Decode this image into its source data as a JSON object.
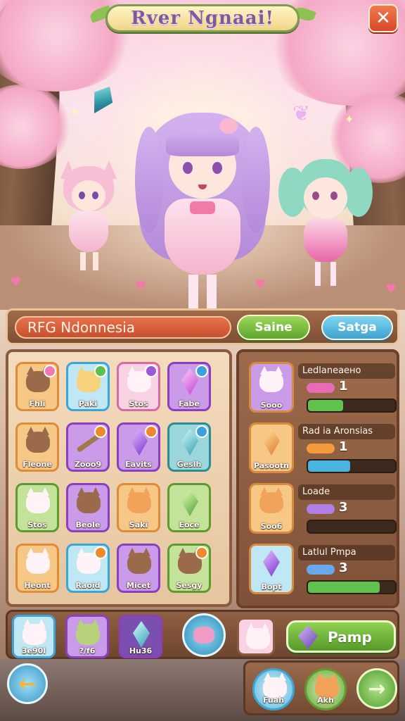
{
  "title": "Rver Ngnaai!",
  "region": {
    "name": "RFG Ndonnesia",
    "save_label": "Saine",
    "setup_label": "Satga"
  },
  "grid": {
    "items": [
      {
        "label": "Fhli",
        "rarity": "orange",
        "art": "cat-brown",
        "badge": "flower"
      },
      {
        "label": "Paki",
        "rarity": "blue",
        "art": "girl-blonde",
        "badge": "green-gem"
      },
      {
        "label": "Stos",
        "rarity": "pink",
        "art": "cat-white",
        "badge": "purple-gem"
      },
      {
        "label": "Fabe",
        "rarity": "purple",
        "art": "gem-pink",
        "badge": "blue-gem"
      },
      {
        "label": "Fleone",
        "rarity": "orange",
        "art": "cat-brown",
        "badge": ""
      },
      {
        "label": "Zooo9",
        "rarity": "purple",
        "art": "sword",
        "badge": "orange-gem"
      },
      {
        "label": "Eavits",
        "rarity": "purple",
        "art": "gem-violet",
        "badge": "orange-gem"
      },
      {
        "label": "Geslh",
        "rarity": "teal",
        "art": "gem-teal",
        "badge": "blue-gem"
      },
      {
        "label": "Stos",
        "rarity": "green",
        "art": "cat-white",
        "badge": ""
      },
      {
        "label": "Beole",
        "rarity": "purple",
        "art": "cat-brown",
        "badge": ""
      },
      {
        "label": "Saki",
        "rarity": "orange",
        "art": "cat-orange",
        "badge": ""
      },
      {
        "label": "Eoce",
        "rarity": "green",
        "art": "gem-green",
        "badge": ""
      },
      {
        "label": "Heont",
        "rarity": "orange",
        "art": "cat-white",
        "badge": ""
      },
      {
        "label": "Raoid",
        "rarity": "blue",
        "art": "cat-white",
        "badge": "orange-gem"
      },
      {
        "label": "Micet",
        "rarity": "purple",
        "art": "cat-brown",
        "badge": ""
      },
      {
        "label": "Sesgy",
        "rarity": "green",
        "art": "cat-brown",
        "badge": "orange-gem"
      }
    ]
  },
  "side": {
    "items": [
      {
        "title": "Ledlaneaено",
        "icon_label": "Sooo",
        "count": "1",
        "count_color": "#e86bb6",
        "progress": 0.4,
        "progress_color": "#62c14e",
        "rarity": "purple",
        "art": "cat-white"
      },
      {
        "title": "Rad ia Aronsias",
        "icon_label": "Pasootn",
        "count": "1",
        "count_color": "#f29a3c",
        "progress": 0.48,
        "progress_color": "#4ab3e0",
        "rarity": "orange",
        "art": "gem-orange"
      },
      {
        "title": "Loade",
        "icon_label": "Soo6",
        "count": "3",
        "count_color": "#b17fe4",
        "progress": 0,
        "progress_color": "#62c14e",
        "rarity": "orange",
        "art": "cat-orange"
      },
      {
        "title": "Latlul Pmpa",
        "icon_label": "Bopt",
        "count": "3",
        "count_color": "#6aa8ec",
        "progress": 0.82,
        "progress_color": "#62c14e",
        "rarity": "blue",
        "art": "gem-violet"
      }
    ]
  },
  "dock": {
    "slots": [
      {
        "label": "3e90l",
        "art": "cat-white"
      },
      {
        "label": "?/f6",
        "art": "cat-green"
      },
      {
        "label": "Hu36",
        "art": "gem-teal"
      }
    ],
    "pump_label": "Pamp"
  },
  "footer": {
    "slots": [
      {
        "label": "Fuah",
        "art": "cat-white"
      },
      {
        "label": "Akh",
        "art": "cat-orange"
      }
    ]
  },
  "colors": {
    "accent_green": "#5ea52c",
    "accent_blue": "#3ea1cf",
    "close_red": "#d9482a",
    "panel_brown": "#8a5b3d"
  }
}
